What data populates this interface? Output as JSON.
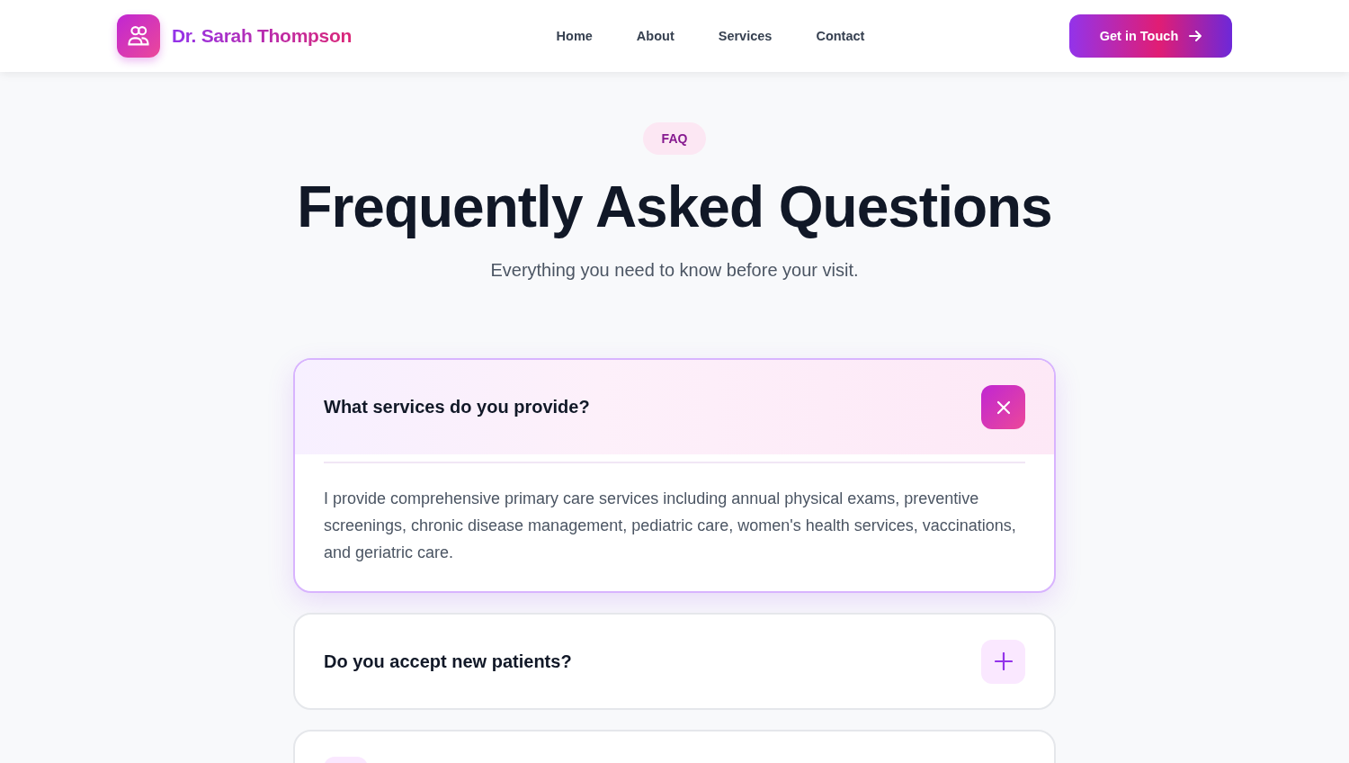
{
  "header": {
    "name": "Dr. Sarah Thompson",
    "nav": [
      "Home",
      "About",
      "Services",
      "Contact"
    ],
    "cta": "Get in Touch"
  },
  "hero": {
    "badge": "FAQ",
    "title": "Frequently Asked Questions",
    "subtitle": "Everything you need to know before your visit."
  },
  "faq": [
    {
      "question": "What services do you provide?",
      "expanded": true,
      "answer": "I provide comprehensive primary care services including annual physical exams, preventive screenings, chronic disease management, pediatric care, women's health services, vaccinations, and geriatric care."
    },
    {
      "question": "Do you accept new patients?",
      "expanded": false
    },
    {
      "expanded": false
    }
  ]
}
